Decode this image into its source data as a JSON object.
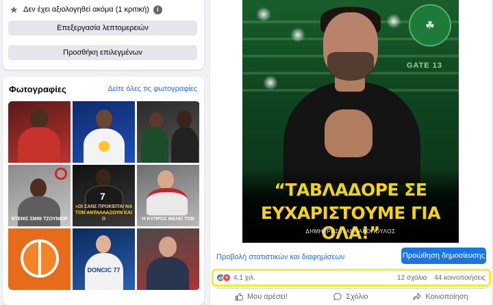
{
  "about": {
    "rating_text": "Δεν έχει αξιολογηθεί ακόμα (1 κριτική)",
    "edit_details": "Επεξεργασία λεπτομερειών",
    "add_featured": "Προσθήκη επιλεγμένων"
  },
  "photos": {
    "title": "Φωτογραφίες",
    "see_all": "Δείτε όλες τις φωτογραφίες",
    "captions": {
      "p4": "ΝΤΕΝΙΣ ΣΜΙΘ ΤΖΟΥΝΙΟΡ",
      "p5": "«ΟΙ ΣΑΝΣ ΠΡΟΚΕΙΤΑΙ ΝΑ ΤΟΝ ΑΝΤΑΛΛΑΞΟΥΝ ΚΑΙ Ο",
      "p6": "Η ΚΥΠΡΟΣ ΘΕΛΕΙ ΤΟΝ",
      "p8": "DONCIC 77"
    }
  },
  "post": {
    "quote_line1": "“ΤΑΒΛΑΔΟΡΕ ΣΕ",
    "quote_line2": "ΕΥΧΑΡΙΣΤΟΥΜΕ ΓΙΑ ΟΛΑ!”",
    "author": "ΔΗΜΗΤΡΗΣ ΓΙΑΝΝΑΚΟΠΟΥΛΟΣ",
    "gate_text": "GATE 13",
    "stats_link": "Προβολή στατιστικών και διαφημίσεων",
    "boost_button": "Προώθηση δημοσίευσης",
    "reaction_count": "4,1 χιλ.",
    "comments": "12 σχόλια",
    "shares": "44 κοινοποιήσεις",
    "actions": {
      "like": "Μου αρέσει!",
      "comment": "Σχόλιο",
      "share": "Κοινοποίηση"
    }
  },
  "icons": {
    "star": "star-icon",
    "info": "info-icon",
    "like_reaction": "like-reaction-icon",
    "love_reaction": "love-reaction-icon",
    "like": "thumbs-up-icon",
    "comment": "comment-bubble-icon",
    "share": "share-arrow-icon"
  },
  "colors": {
    "link": "#216fdb",
    "primary_button": "#1b74e4",
    "highlight_box": "#f2ee2a",
    "quote_text": "#f6d312"
  }
}
